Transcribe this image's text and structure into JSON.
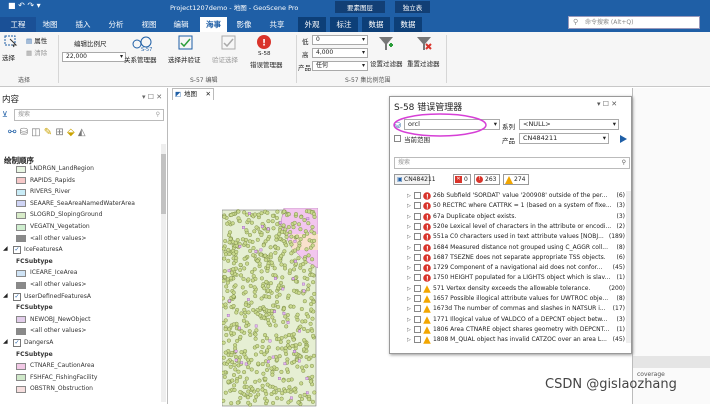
{
  "titlebar": {
    "title": "Project1207demo - 地图 - GeoScene Pro",
    "context_left": "要素图层",
    "context_right": "独立表"
  },
  "tabs": [
    "工程",
    "地图",
    "插入",
    "分析",
    "视图",
    "编辑",
    "海事",
    "影像",
    "共享",
    "外观",
    "标注",
    "数据",
    "数据"
  ],
  "active_tab": "海事",
  "search_placeholder": "命令搜索 (Alt+Q)",
  "ribbon": {
    "select_label": "选择",
    "attributes_label": "属性",
    "clear_label": "清除",
    "selection_group": "选择",
    "scale_label": "编辑比例尺",
    "scale_value": "22,000",
    "relation_manager": "关系管理器",
    "s57_badge": "S-57",
    "select_and_validate": "选择并验证",
    "validate_selected": "验证选择",
    "s58_badge": "S-58",
    "error_manager": "错误管理器",
    "edit_group": "S-57 编辑",
    "low_label": "低",
    "low_value": "0",
    "high_label": "高",
    "high_value": "4,000",
    "product_label": "产品",
    "product_value": "任何",
    "set_filter": "设置过滤器",
    "reset_filter": "重置过滤器",
    "scale_range_group": "S-57 集比例范围"
  },
  "contents": {
    "title": "内容",
    "search_placeholder": "搜索",
    "drawing_order": "绘制顺序",
    "layers": [
      {
        "label": "LNDRGN_LandRegion",
        "color": "#e9f6e3",
        "type": "item"
      },
      {
        "label": "RAPIDS_Rapids",
        "color": "#f7c9c9",
        "type": "item"
      },
      {
        "label": "RIVERS_River",
        "color": "#c9ecf7",
        "type": "item"
      },
      {
        "label": "SEAARE_SeaAreaNamedWaterArea",
        "color": "#cfd4f5",
        "type": "item"
      },
      {
        "label": "SLOGRD_SlopingGround",
        "color": "#d8ecc9",
        "type": "item"
      },
      {
        "label": "VEGATN_Vegetation",
        "color": "#cfeecf",
        "type": "item"
      },
      {
        "label": "<all other values>",
        "color": "#8a8a8a",
        "type": "item"
      },
      {
        "label": "IceFeaturesA",
        "type": "group"
      },
      {
        "label": "FCSubtype",
        "type": "sub"
      },
      {
        "label": "ICEARE_IceArea",
        "color": "#cfe3f5",
        "type": "item"
      },
      {
        "label": "<all other values>",
        "color": "#8a8a8a",
        "type": "item"
      },
      {
        "label": "UserDefinedFeaturesA",
        "type": "group"
      },
      {
        "label": "FCSubtype",
        "type": "sub"
      },
      {
        "label": "NEWOBJ_NewObject",
        "color": "#e2cdea",
        "type": "item"
      },
      {
        "label": "<all other values>",
        "color": "#8a8a8a",
        "type": "item"
      },
      {
        "label": "DangersA",
        "type": "group"
      },
      {
        "label": "FCSubtype",
        "type": "sub"
      },
      {
        "label": "CTNARE_CautionArea",
        "color": "#f2c9e6",
        "type": "item"
      },
      {
        "label": "FSHFAC_FishingFacility",
        "color": "#cfe8c9",
        "type": "item"
      },
      {
        "label": "OBSTRN_Obstruction",
        "color": "#f6dede",
        "type": "item"
      }
    ]
  },
  "map_tab": "地图",
  "right_panel_top": "目录",
  "right_panel_bottom": "coverage",
  "dialog": {
    "title": "S-58 错误管理器",
    "db_value": "orcl",
    "series_label": "系列",
    "series_value": "<NULL>",
    "current_extent": "当前范围",
    "product_label": "产品",
    "product_value": "CN484211",
    "search_placeholder": "搜索",
    "summary_product": "CN484211",
    "count_a": "0",
    "count_b": "263",
    "count_c": "274",
    "errors": [
      {
        "sev": "error",
        "text": "26b Subfield 'SORDAT' value '200908' outside of the per...",
        "count": "(6)"
      },
      {
        "sev": "error",
        "text": "50 RECTRC where CATTRK = 1 (based on a system of fixe...",
        "count": "(3)"
      },
      {
        "sev": "error",
        "text": "67a Duplicate object exists.",
        "count": "(3)"
      },
      {
        "sev": "error",
        "text": "520e Lexical level of characters in the attribute or encodi...",
        "count": "(2)"
      },
      {
        "sev": "error",
        "text": "551a C0 characters used in text attribute values [NOBJ...",
        "count": "(189)"
      },
      {
        "sev": "error",
        "text": "1684 Measured distance not grouped using C_AGGR coll...",
        "count": "(8)"
      },
      {
        "sev": "error",
        "text": "1687 TSEZNE does not separate appropriate TSS objects.",
        "count": "(6)"
      },
      {
        "sev": "error",
        "text": "1729 Component of a navigational aid does not confor...",
        "count": "(45)"
      },
      {
        "sev": "error",
        "text": "1750 HEIGHT populated for a LIGHTS object which is slav...",
        "count": "(1)"
      },
      {
        "sev": "warning",
        "text": "571 Vertex density exceeds the allowable tolerance.",
        "count": "(200)"
      },
      {
        "sev": "warning",
        "text": "1657 Possible illogical attribute values for UWTROC obje...",
        "count": "(8)"
      },
      {
        "sev": "warning",
        "text": "1673d The number of commas and slashes in NATSUR i...",
        "count": "(17)"
      },
      {
        "sev": "warning",
        "text": "1771 Illogical value of VALDCO of a DEPCNT object betw...",
        "count": "(3)"
      },
      {
        "sev": "warning",
        "text": "1806 Area CTNARE object shares geometry with DEPCNT...",
        "count": "(1)"
      },
      {
        "sev": "warning",
        "text": "1808 M_QUAL object has invalid CATZOC over an area L...",
        "count": "(45)"
      }
    ]
  },
  "watermark": "CSDN @gislaozhang",
  "colors": {
    "accent": "#1f5fa6",
    "annotation": "#d63fd6",
    "error": "#d9342b",
    "warning": "#f2a600",
    "info": "#2d7fd3"
  }
}
